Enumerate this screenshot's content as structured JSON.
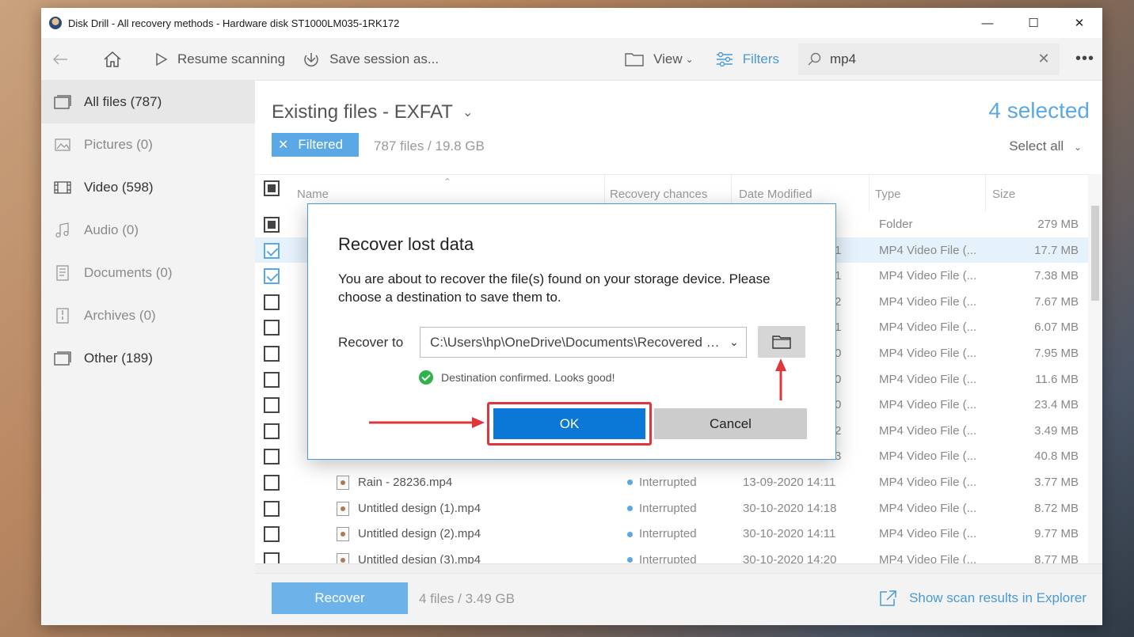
{
  "window": {
    "title": "Disk Drill - All recovery methods - Hardware disk ST1000LM035-1RK172"
  },
  "toolbar": {
    "resume_label": "Resume scanning",
    "save_label": "Save session as...",
    "view_label": "View",
    "filters_label": "Filters",
    "search_value": "mp4"
  },
  "sidebar": {
    "items": [
      {
        "label": "All files (787)"
      },
      {
        "label": "Pictures (0)"
      },
      {
        "label": "Video (598)"
      },
      {
        "label": "Audio (0)"
      },
      {
        "label": "Documents (0)"
      },
      {
        "label": "Archives (0)"
      },
      {
        "label": "Other (189)"
      }
    ]
  },
  "main": {
    "heading": "Existing files - EXFAT",
    "filtered_label": "Filtered",
    "file_count": "787 files / 19.8 GB",
    "selected_count": "4 selected",
    "select_all": "Select all"
  },
  "table": {
    "columns": [
      "Name",
      "Recovery chances",
      "Date Modified",
      "Type",
      "Size"
    ],
    "rows": [
      {
        "name": "",
        "status": "",
        "date": "",
        "type": "Folder",
        "size": "279 MB"
      },
      {
        "name": "",
        "status": "",
        "date": "1",
        "type": "MP4 Video File (...",
        "size": "17.7 MB"
      },
      {
        "name": "",
        "status": "",
        "date": "1",
        "type": "MP4 Video File (...",
        "size": "7.38 MB"
      },
      {
        "name": "",
        "status": "",
        "date": "2",
        "type": "MP4 Video File (...",
        "size": "7.67 MB"
      },
      {
        "name": "",
        "status": "",
        "date": "1",
        "type": "MP4 Video File (...",
        "size": "6.07 MB"
      },
      {
        "name": "",
        "status": "",
        "date": "0",
        "type": "MP4 Video File (...",
        "size": "7.95 MB"
      },
      {
        "name": "",
        "status": "",
        "date": "0",
        "type": "MP4 Video File (...",
        "size": "11.6 MB"
      },
      {
        "name": "",
        "status": "",
        "date": "0",
        "type": "MP4 Video File (...",
        "size": "23.4 MB"
      },
      {
        "name": "",
        "status": "",
        "date": "2",
        "type": "MP4 Video File (...",
        "size": "3.49 MB"
      },
      {
        "name": "",
        "status": "",
        "date": "3",
        "type": "MP4 Video File (...",
        "size": "40.8 MB"
      },
      {
        "name": "Rain - 28236.mp4",
        "status": "Interrupted",
        "date": "13-09-2020 14:11",
        "type": "MP4 Video File (...",
        "size": "3.77 MB"
      },
      {
        "name": "Untitled design (1).mp4",
        "status": "Interrupted",
        "date": "30-10-2020 14:18",
        "type": "MP4 Video File (...",
        "size": "8.72 MB"
      },
      {
        "name": "Untitled design (2).mp4",
        "status": "Interrupted",
        "date": "30-10-2020 14:11",
        "type": "MP4 Video File (...",
        "size": "9.77 MB"
      },
      {
        "name": "Untitled design (3).mp4",
        "status": "Interrupted",
        "date": "30-10-2020 14:20",
        "type": "MP4 Video File (...",
        "size": "8.77 MB"
      }
    ]
  },
  "footer": {
    "recover_label": "Recover",
    "info": "4 files / 3.49 GB",
    "explorer_label": "Show scan results in Explorer"
  },
  "dialog": {
    "title": "Recover lost data",
    "message": "You are about to recover the file(s) found on your storage device. Please choose a destination to save them to.",
    "recover_to_label": "Recover to",
    "destination": "C:\\Users\\hp\\OneDrive\\Documents\\Recovered data",
    "confirm_text": "Destination confirmed. Looks good!",
    "ok_label": "OK",
    "cancel_label": "Cancel"
  },
  "colors": {
    "accent": "#5aa9e6",
    "ok_button": "#0b77d6",
    "highlight_red": "#e0353b",
    "confirm_green": "#2fb24a"
  }
}
